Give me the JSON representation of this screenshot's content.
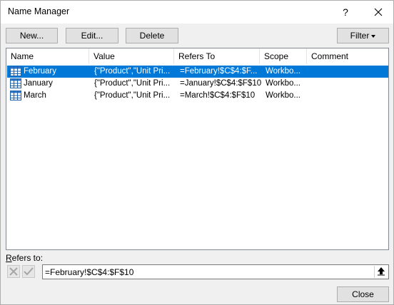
{
  "dialog": {
    "title": "Name Manager",
    "help": "?",
    "close_window_icon": "close-icon"
  },
  "toolbar": {
    "new_label": "New...",
    "edit_label": "Edit...",
    "delete_label": "Delete",
    "filter_label": "Filter"
  },
  "list": {
    "columns": [
      "Name",
      "Value",
      "Refers To",
      "Scope",
      "Comment"
    ],
    "rows": [
      {
        "name": "February",
        "value": "{\"Product\",\"Unit Pri...",
        "refers_to": "=February!$C$4:$F...",
        "scope": "Workbo...",
        "comment": "",
        "icon": "table-icon",
        "selected": true
      },
      {
        "name": "January",
        "value": "{\"Product\",\"Unit Pri...",
        "refers_to": "=January!$C$4:$F$10",
        "scope": "Workbo...",
        "comment": "",
        "icon": "table-icon",
        "selected": false
      },
      {
        "name": "March",
        "value": "{\"Product\",\"Unit Pri...",
        "refers_to": "=March!$C$4:$F$10",
        "scope": "Workbo...",
        "comment": "",
        "icon": "table-icon",
        "selected": false
      }
    ]
  },
  "refers": {
    "label_prefix": "R",
    "label_rest": "efers to:",
    "value": "=February!$C$4:$F$10"
  },
  "footer": {
    "close_label": "Close"
  },
  "colors": {
    "selection": "#0078d7",
    "dialog_bg": "#f0f0f0"
  }
}
